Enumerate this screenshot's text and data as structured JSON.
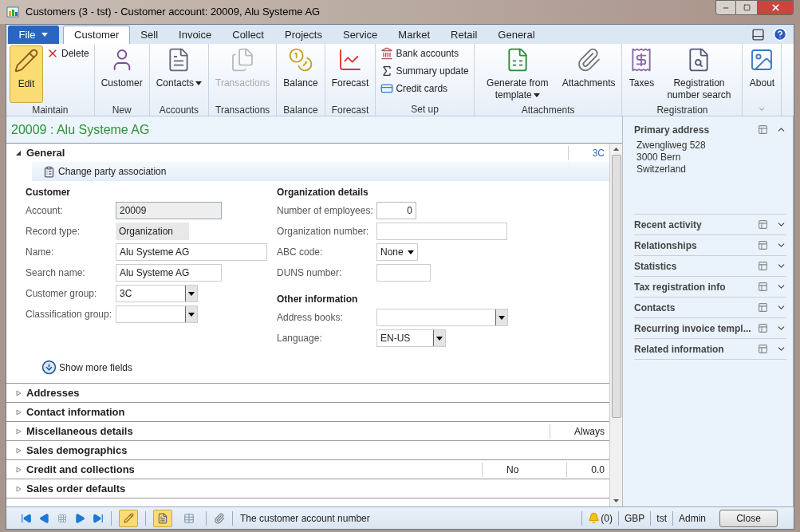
{
  "window": {
    "title": "Customers (3 - tst) - Customer account: 20009, Alu Systeme AG"
  },
  "ribbon_tabs": [
    {
      "label": "File",
      "kind": "file",
      "selected": false
    },
    {
      "label": "Customer",
      "kind": "tab",
      "selected": true
    },
    {
      "label": "Sell",
      "kind": "tab",
      "selected": false
    },
    {
      "label": "Invoice",
      "kind": "tab",
      "selected": false
    },
    {
      "label": "Collect",
      "kind": "tab",
      "selected": false
    },
    {
      "label": "Projects",
      "kind": "tab",
      "selected": false
    },
    {
      "label": "Service",
      "kind": "tab",
      "selected": false
    },
    {
      "label": "Market",
      "kind": "tab",
      "selected": false
    },
    {
      "label": "Retail",
      "kind": "tab",
      "selected": false
    },
    {
      "label": "General",
      "kind": "tab",
      "selected": false
    }
  ],
  "ribbon_groups": [
    {
      "label": "Maintain",
      "items": [
        {
          "kind": "large",
          "label": "Edit",
          "pressed": true,
          "disabled": false,
          "dropdown": false
        },
        {
          "kind": "small",
          "label": "Delete",
          "pressed": false,
          "disabled": false,
          "dropdown": false
        }
      ]
    },
    {
      "label": "New",
      "items": [
        {
          "kind": "large",
          "label": "Customer",
          "pressed": false,
          "disabled": false,
          "dropdown": false
        }
      ]
    },
    {
      "label": "Accounts",
      "items": [
        {
          "kind": "large",
          "label": "Contacts",
          "pressed": false,
          "disabled": false,
          "dropdown": true
        }
      ]
    },
    {
      "label": "Transactions",
      "items": [
        {
          "kind": "large",
          "label": "Transactions",
          "pressed": false,
          "disabled": true,
          "dropdown": false
        }
      ]
    },
    {
      "label": "Balance",
      "items": [
        {
          "kind": "large",
          "label": "Balance",
          "pressed": false,
          "disabled": false,
          "dropdown": false
        }
      ]
    },
    {
      "label": "Forecast",
      "items": [
        {
          "kind": "large",
          "label": "Forecast",
          "pressed": false,
          "disabled": false,
          "dropdown": false
        }
      ]
    },
    {
      "label": "Set up",
      "items": [
        {
          "kind": "small",
          "label": "Bank accounts",
          "pressed": false,
          "disabled": false,
          "dropdown": false
        },
        {
          "kind": "small",
          "label": "Summary update",
          "pressed": false,
          "disabled": false,
          "dropdown": false
        },
        {
          "kind": "small",
          "label": "Credit cards",
          "pressed": false,
          "disabled": false,
          "dropdown": false
        }
      ]
    },
    {
      "label": "Attachments",
      "items": [
        {
          "kind": "large",
          "label": "Generate from template",
          "pressed": false,
          "disabled": false,
          "dropdown": true
        },
        {
          "kind": "large",
          "label": "Attachments",
          "pressed": false,
          "disabled": false,
          "dropdown": false
        }
      ]
    },
    {
      "label": "Registration",
      "items": [
        {
          "kind": "large",
          "label": "Taxes",
          "pressed": false,
          "disabled": false,
          "dropdown": false
        },
        {
          "kind": "large",
          "label": "Registration number search",
          "pressed": false,
          "disabled": false,
          "dropdown": false
        }
      ]
    },
    {
      "items": [
        {
          "kind": "large",
          "label": "About",
          "pressed": false,
          "disabled": false,
          "dropdown": false
        }
      ]
    }
  ],
  "record_header": "20009 : Alu Systeme AG",
  "sections": [
    {
      "title": "General",
      "expanded": true,
      "summary": [
        "3C"
      ]
    },
    {
      "title": "Addresses",
      "expanded": false
    },
    {
      "title": "Contact information",
      "expanded": false
    },
    {
      "title": "Miscellaneous details",
      "expanded": false,
      "summary": [
        "Always"
      ]
    },
    {
      "title": "Sales demographics",
      "expanded": false
    },
    {
      "title": "Credit and collections",
      "expanded": false,
      "summary": [
        "No",
        "0.0"
      ]
    },
    {
      "title": "Sales order defaults",
      "expanded": false
    }
  ],
  "general": {
    "action": "Change party association",
    "columns": [
      {
        "groups": [
          {
            "title": "Customer",
            "fields": [
              {
                "label": "Account:",
                "kind": "readonly",
                "value": "20009"
              },
              {
                "label": "Record type:",
                "kind": "static",
                "value": "Organization"
              },
              {
                "label": "Name:",
                "kind": "text",
                "value": "Alu Systeme AG"
              },
              {
                "label": "Search name:",
                "kind": "text",
                "value": "Alu Systeme AG"
              },
              {
                "label": "Customer group:",
                "kind": "combo",
                "value": "3C"
              },
              {
                "label": "Classification group:",
                "kind": "combo"
              }
            ]
          }
        ]
      },
      {
        "groups": [
          {
            "title": "Organization details",
            "fields": [
              {
                "label": "Number of employees:",
                "kind": "number",
                "value": "0"
              },
              {
                "label": "Organization number:",
                "kind": "text"
              },
              {
                "label": "ABC code:",
                "kind": "enum",
                "value": "None"
              },
              {
                "label": "DUNS number:",
                "kind": "text"
              }
            ]
          },
          {
            "title": "Other information",
            "fields": [
              {
                "label": "Address books:",
                "kind": "combo"
              },
              {
                "label": "Language:",
                "kind": "combo",
                "value": "EN-US"
              }
            ]
          }
        ]
      }
    ],
    "show_more": "Show more fields"
  },
  "factbox": [
    {
      "title": "Primary address",
      "expanded": true,
      "lines": [
        "Zwengliweg 528",
        "3000 Bern",
        "Switzerland"
      ]
    },
    {
      "title": "Recent activity",
      "expanded": false
    },
    {
      "title": "Relationships",
      "expanded": false
    },
    {
      "title": "Statistics",
      "expanded": false
    },
    {
      "title": "Tax registration info",
      "expanded": false
    },
    {
      "title": "Contacts",
      "expanded": false
    },
    {
      "title": "Recurring invoice templ...",
      "expanded": false
    },
    {
      "title": "Related information",
      "expanded": false
    }
  ],
  "status_bar": {
    "edit_mode": true,
    "views": [
      {
        "selected": true
      },
      {
        "selected": false
      }
    ],
    "message": "The customer account number",
    "alerts": "(0)",
    "currency": "GBP",
    "company": "tst",
    "user": "Admin",
    "close": "Close"
  }
}
